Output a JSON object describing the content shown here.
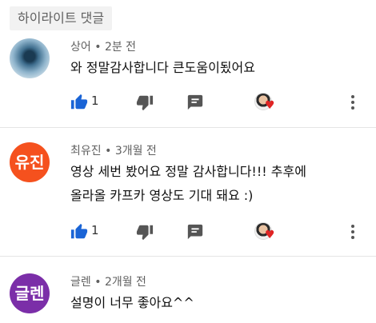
{
  "section_title": "하이라이트 댓글",
  "comments": [
    {
      "author": "상어",
      "time": "2분 전",
      "lines": [
        "와 정말감사합니다 큰도움이됬어요"
      ],
      "likes": "1",
      "avatar_text": "",
      "avatar_color": "#3f6e8e"
    },
    {
      "author": "최유진",
      "time": "3개월 전",
      "lines": [
        "영상 세번 봤어요 정말 감사합니다!!! 추후에",
        "올라올 카프카 영상도 기대 돼요 :)"
      ],
      "likes": "1",
      "avatar_text": "유진",
      "avatar_color": "#f5511e"
    },
    {
      "author": "글렌",
      "time": "2개월 전",
      "lines": [
        "설명이 너무 좋아요^^"
      ],
      "avatar_text": "글렌",
      "avatar_color": "#7b2ea8"
    }
  ],
  "separator": "•",
  "icons": {
    "like": "thumbs-up-icon",
    "dislike": "thumbs-down-icon",
    "reply": "reply-icon",
    "creator_heart": "creator-heart-icon",
    "more": "more-vert-icon"
  },
  "colors": {
    "like_blue": "#1a64d6",
    "icon_gray": "#555555",
    "heart_red": "#e02424"
  }
}
